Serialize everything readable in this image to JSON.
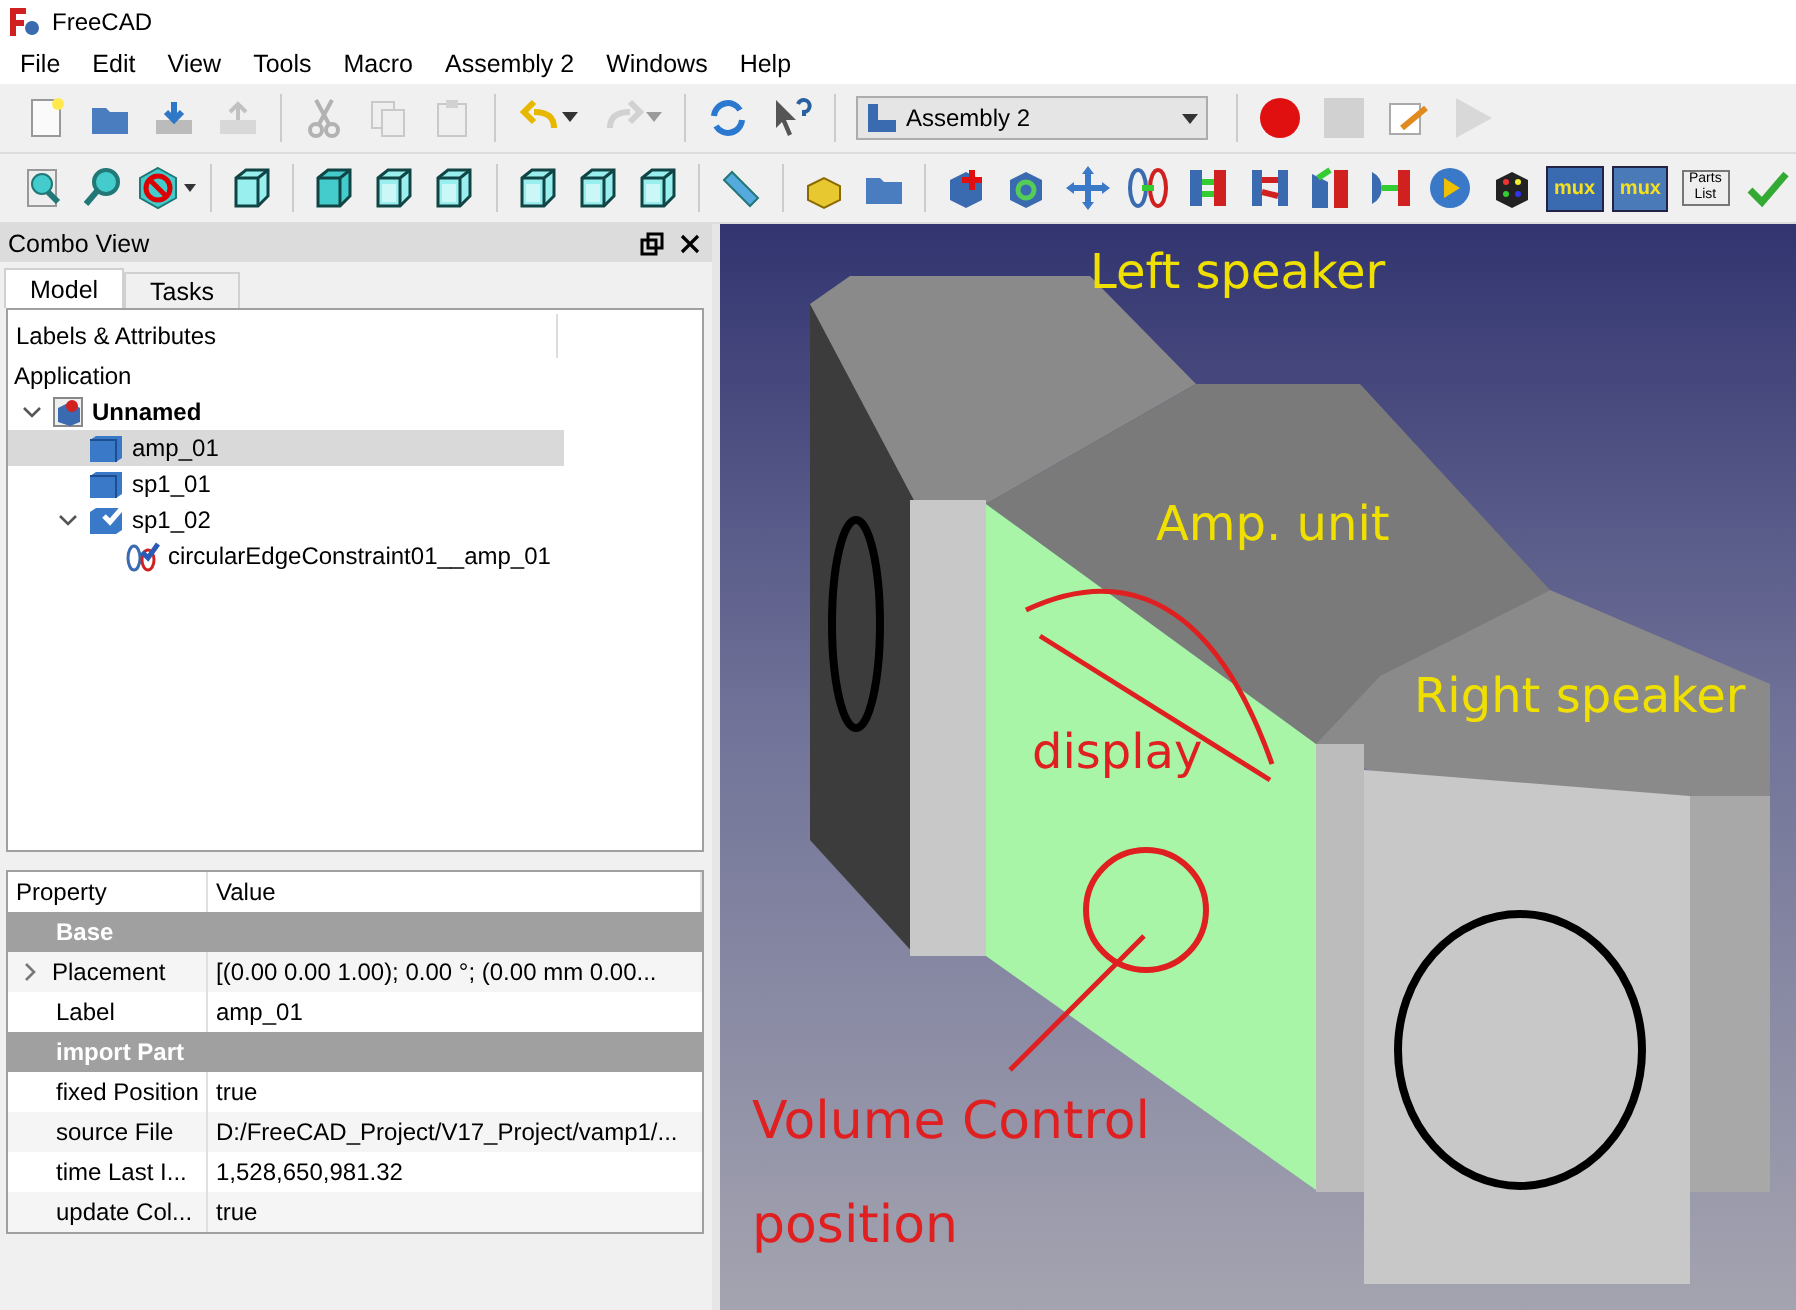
{
  "window": {
    "title": "FreeCAD"
  },
  "menu": [
    "File",
    "Edit",
    "View",
    "Tools",
    "Macro",
    "Assembly 2",
    "Windows",
    "Help"
  ],
  "toolbar_1": [
    {
      "kind": "new",
      "disabled": false
    },
    {
      "kind": "open",
      "disabled": false
    },
    {
      "kind": "save",
      "disabled": false
    },
    {
      "kind": "export",
      "disabled": true
    },
    {
      "kind": "sep"
    },
    {
      "kind": "cut",
      "disabled": true
    },
    {
      "kind": "copy",
      "disabled": true
    },
    {
      "kind": "paste",
      "disabled": true
    },
    {
      "kind": "sep"
    },
    {
      "kind": "undo",
      "disabled": false
    },
    {
      "kind": "redo",
      "disabled": true
    },
    {
      "kind": "sep"
    },
    {
      "kind": "refresh",
      "disabled": false
    },
    {
      "kind": "whatsthis",
      "disabled": false
    }
  ],
  "workbench": {
    "value": "Assembly 2"
  },
  "macro_toolbar": [
    {
      "kind": "record",
      "disabled": false
    },
    {
      "kind": "stop",
      "disabled": true
    },
    {
      "kind": "editmacro",
      "disabled": false
    },
    {
      "kind": "play",
      "disabled": true
    }
  ],
  "toolbar_2": [
    {
      "kind": "fitall"
    },
    {
      "kind": "fitsel"
    },
    {
      "kind": "drawstyle"
    },
    {
      "kind": "sep"
    },
    {
      "kind": "cubeiso"
    },
    {
      "kind": "sep"
    },
    {
      "kind": "cubefront"
    },
    {
      "kind": "cubetop"
    },
    {
      "kind": "cuberight"
    },
    {
      "kind": "sep"
    },
    {
      "kind": "cuberear"
    },
    {
      "kind": "cubebottom"
    },
    {
      "kind": "cubeleft"
    },
    {
      "kind": "sep"
    },
    {
      "kind": "ruler"
    },
    {
      "kind": "sep"
    },
    {
      "kind": "part"
    },
    {
      "kind": "folder"
    },
    {
      "kind": "sep"
    },
    {
      "kind": "addpart"
    },
    {
      "kind": "updatepart"
    },
    {
      "kind": "move"
    },
    {
      "kind": "circular"
    },
    {
      "kind": "plane"
    },
    {
      "kind": "planeangle"
    },
    {
      "kind": "angle"
    },
    {
      "kind": "sphere"
    },
    {
      "kind": "animate"
    },
    {
      "kind": "rubik"
    },
    {
      "kind": "mux",
      "text": "mux"
    },
    {
      "kind": "mux2",
      "text": "mux"
    },
    {
      "kind": "partslist",
      "text": "Parts List"
    },
    {
      "kind": "check"
    }
  ],
  "combo_view": {
    "title": "Combo View",
    "tabs": [
      {
        "label": "Model",
        "selected": true
      },
      {
        "label": "Tasks",
        "selected": false
      }
    ]
  },
  "tree": {
    "header": "Labels & Attributes",
    "section": "Application",
    "items": [
      {
        "label": "Unnamed",
        "kind": "document",
        "expanded": true,
        "selected": false,
        "children": [
          {
            "label": "amp_01",
            "kind": "part",
            "selected": true
          },
          {
            "label": "sp1_01",
            "kind": "part",
            "selected": false
          },
          {
            "label": "sp1_02",
            "kind": "partfixed",
            "selected": false,
            "expanded": true,
            "children": [
              {
                "label": "circularEdgeConstraint01__amp_01",
                "kind": "constraint",
                "selected": false
              }
            ]
          }
        ]
      }
    ]
  },
  "properties": {
    "columns": [
      "Property",
      "Value"
    ],
    "rows": [
      {
        "kind": "group",
        "name": "Base"
      },
      {
        "kind": "prop",
        "name": "Placement",
        "value": "[(0.00 0.00 1.00); 0.00 °; (0.00 mm  0.00...",
        "expanded": false
      },
      {
        "kind": "prop",
        "name": "Label",
        "value": "amp_01"
      },
      {
        "kind": "group",
        "name": "import Part"
      },
      {
        "kind": "prop",
        "name": "fixed Position",
        "value": "true"
      },
      {
        "kind": "prop",
        "name": "source File",
        "value": "D:/FreeCAD_Project/V17_Project/vamp1/..."
      },
      {
        "kind": "prop",
        "name": "time Last I...",
        "value": "1,528,650,981.32"
      },
      {
        "kind": "prop",
        "name": "update Col...",
        "value": "true"
      }
    ]
  },
  "viewport": {
    "annotations": [
      {
        "text": "Left speaker",
        "kind": "label"
      },
      {
        "text": "Amp. unit",
        "kind": "label"
      },
      {
        "text": "Right speaker",
        "kind": "label"
      },
      {
        "text": "display",
        "kind": "note"
      },
      {
        "text": "Volume Control",
        "kind": "note"
      },
      {
        "text": "position",
        "kind": "note"
      }
    ]
  }
}
